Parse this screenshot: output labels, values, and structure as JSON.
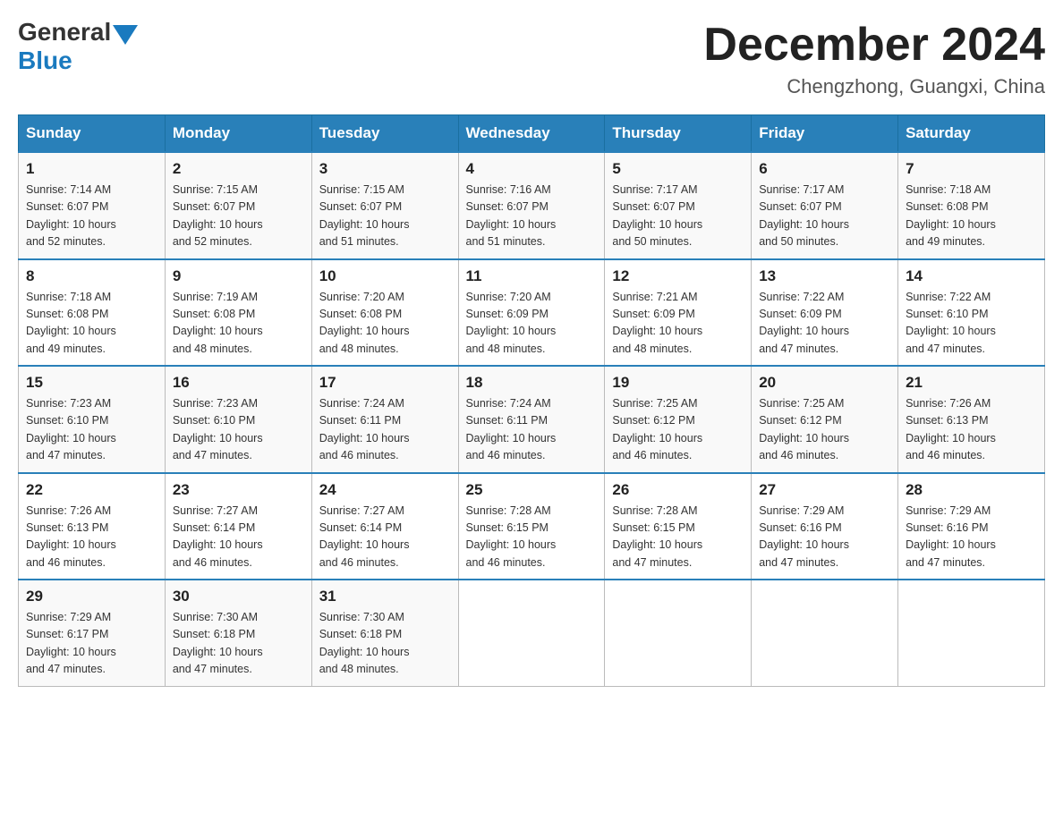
{
  "logo": {
    "general": "General",
    "triangle": "",
    "blue": "Blue"
  },
  "title": "December 2024",
  "location": "Chengzhong, Guangxi, China",
  "days_of_week": [
    "Sunday",
    "Monday",
    "Tuesday",
    "Wednesday",
    "Thursday",
    "Friday",
    "Saturday"
  ],
  "weeks": [
    [
      {
        "day": "1",
        "sunrise": "7:14 AM",
        "sunset": "6:07 PM",
        "daylight": "10 hours and 52 minutes."
      },
      {
        "day": "2",
        "sunrise": "7:15 AM",
        "sunset": "6:07 PM",
        "daylight": "10 hours and 52 minutes."
      },
      {
        "day": "3",
        "sunrise": "7:15 AM",
        "sunset": "6:07 PM",
        "daylight": "10 hours and 51 minutes."
      },
      {
        "day": "4",
        "sunrise": "7:16 AM",
        "sunset": "6:07 PM",
        "daylight": "10 hours and 51 minutes."
      },
      {
        "day": "5",
        "sunrise": "7:17 AM",
        "sunset": "6:07 PM",
        "daylight": "10 hours and 50 minutes."
      },
      {
        "day": "6",
        "sunrise": "7:17 AM",
        "sunset": "6:07 PM",
        "daylight": "10 hours and 50 minutes."
      },
      {
        "day": "7",
        "sunrise": "7:18 AM",
        "sunset": "6:08 PM",
        "daylight": "10 hours and 49 minutes."
      }
    ],
    [
      {
        "day": "8",
        "sunrise": "7:18 AM",
        "sunset": "6:08 PM",
        "daylight": "10 hours and 49 minutes."
      },
      {
        "day": "9",
        "sunrise": "7:19 AM",
        "sunset": "6:08 PM",
        "daylight": "10 hours and 48 minutes."
      },
      {
        "day": "10",
        "sunrise": "7:20 AM",
        "sunset": "6:08 PM",
        "daylight": "10 hours and 48 minutes."
      },
      {
        "day": "11",
        "sunrise": "7:20 AM",
        "sunset": "6:09 PM",
        "daylight": "10 hours and 48 minutes."
      },
      {
        "day": "12",
        "sunrise": "7:21 AM",
        "sunset": "6:09 PM",
        "daylight": "10 hours and 48 minutes."
      },
      {
        "day": "13",
        "sunrise": "7:22 AM",
        "sunset": "6:09 PM",
        "daylight": "10 hours and 47 minutes."
      },
      {
        "day": "14",
        "sunrise": "7:22 AM",
        "sunset": "6:10 PM",
        "daylight": "10 hours and 47 minutes."
      }
    ],
    [
      {
        "day": "15",
        "sunrise": "7:23 AM",
        "sunset": "6:10 PM",
        "daylight": "10 hours and 47 minutes."
      },
      {
        "day": "16",
        "sunrise": "7:23 AM",
        "sunset": "6:10 PM",
        "daylight": "10 hours and 47 minutes."
      },
      {
        "day": "17",
        "sunrise": "7:24 AM",
        "sunset": "6:11 PM",
        "daylight": "10 hours and 46 minutes."
      },
      {
        "day": "18",
        "sunrise": "7:24 AM",
        "sunset": "6:11 PM",
        "daylight": "10 hours and 46 minutes."
      },
      {
        "day": "19",
        "sunrise": "7:25 AM",
        "sunset": "6:12 PM",
        "daylight": "10 hours and 46 minutes."
      },
      {
        "day": "20",
        "sunrise": "7:25 AM",
        "sunset": "6:12 PM",
        "daylight": "10 hours and 46 minutes."
      },
      {
        "day": "21",
        "sunrise": "7:26 AM",
        "sunset": "6:13 PM",
        "daylight": "10 hours and 46 minutes."
      }
    ],
    [
      {
        "day": "22",
        "sunrise": "7:26 AM",
        "sunset": "6:13 PM",
        "daylight": "10 hours and 46 minutes."
      },
      {
        "day": "23",
        "sunrise": "7:27 AM",
        "sunset": "6:14 PM",
        "daylight": "10 hours and 46 minutes."
      },
      {
        "day": "24",
        "sunrise": "7:27 AM",
        "sunset": "6:14 PM",
        "daylight": "10 hours and 46 minutes."
      },
      {
        "day": "25",
        "sunrise": "7:28 AM",
        "sunset": "6:15 PM",
        "daylight": "10 hours and 46 minutes."
      },
      {
        "day": "26",
        "sunrise": "7:28 AM",
        "sunset": "6:15 PM",
        "daylight": "10 hours and 47 minutes."
      },
      {
        "day": "27",
        "sunrise": "7:29 AM",
        "sunset": "6:16 PM",
        "daylight": "10 hours and 47 minutes."
      },
      {
        "day": "28",
        "sunrise": "7:29 AM",
        "sunset": "6:16 PM",
        "daylight": "10 hours and 47 minutes."
      }
    ],
    [
      {
        "day": "29",
        "sunrise": "7:29 AM",
        "sunset": "6:17 PM",
        "daylight": "10 hours and 47 minutes."
      },
      {
        "day": "30",
        "sunrise": "7:30 AM",
        "sunset": "6:18 PM",
        "daylight": "10 hours and 47 minutes."
      },
      {
        "day": "31",
        "sunrise": "7:30 AM",
        "sunset": "6:18 PM",
        "daylight": "10 hours and 48 minutes."
      },
      null,
      null,
      null,
      null
    ]
  ],
  "labels": {
    "sunrise": "Sunrise:",
    "sunset": "Sunset:",
    "daylight": "Daylight:"
  }
}
